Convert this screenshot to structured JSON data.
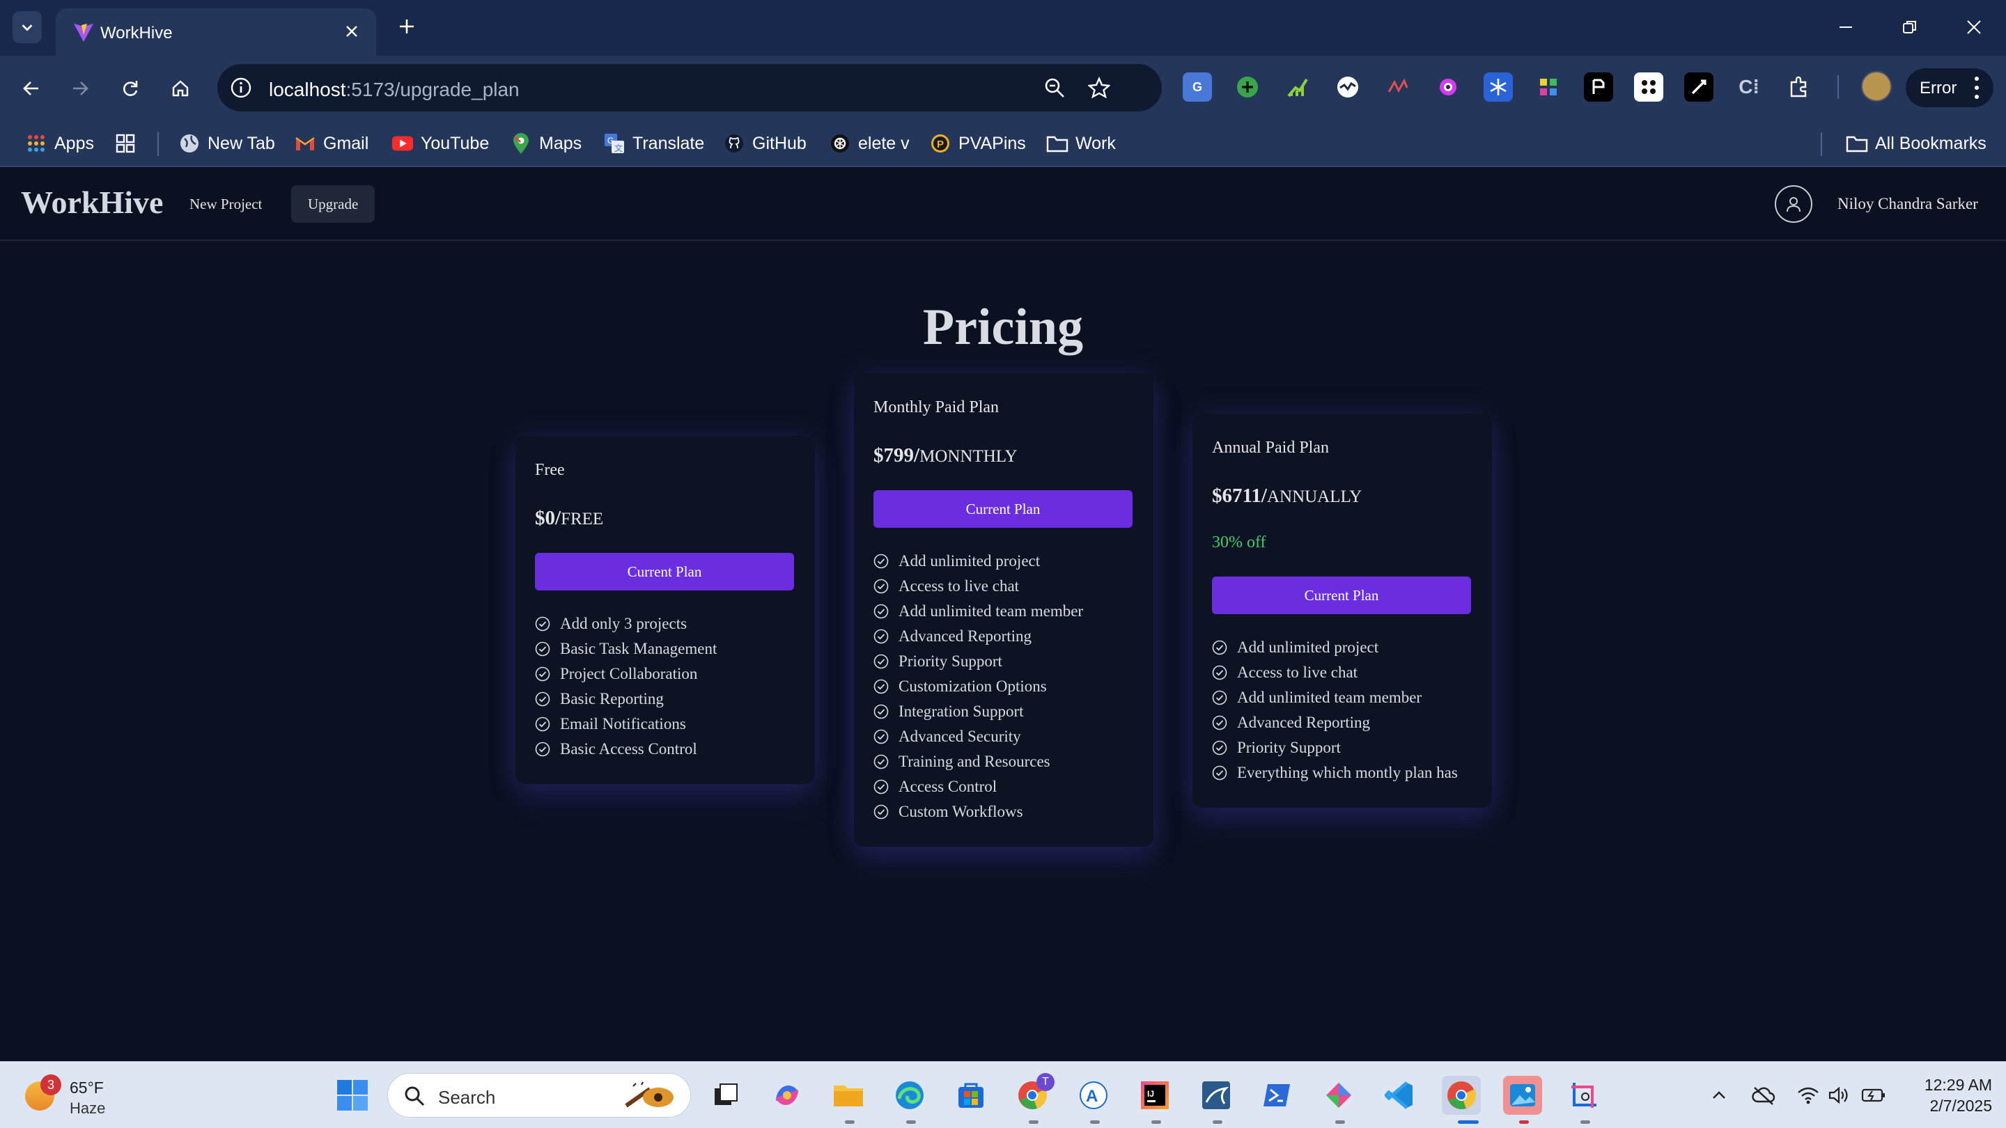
{
  "browser": {
    "tab_title": "WorkHive",
    "url_host": "localhost",
    "url_path": ":5173/upgrade_plan",
    "profile_chip": "Error",
    "bookmarks": [
      {
        "label": "Apps",
        "icon": "apps-grid-icon"
      },
      {
        "label": "",
        "icon": "tab-groups-icon"
      },
      {
        "label": "New Tab",
        "icon": "globe-icon"
      },
      {
        "label": "Gmail",
        "icon": "gmail-icon"
      },
      {
        "label": "YouTube",
        "icon": "youtube-icon"
      },
      {
        "label": "Maps",
        "icon": "maps-pin-icon"
      },
      {
        "label": "Translate",
        "icon": "translate-icon"
      },
      {
        "label": "GitHub",
        "icon": "github-icon"
      },
      {
        "label": "elete v",
        "icon": "openai-icon"
      },
      {
        "label": "PVAPins",
        "icon": "pvapins-icon"
      },
      {
        "label": "Work",
        "icon": "folder-icon"
      }
    ],
    "all_bookmarks": "All Bookmarks"
  },
  "app": {
    "brand": "WorkHive",
    "nav": {
      "new_project": "New Project",
      "upgrade": "Upgrade"
    },
    "user_name": "Niloy Chandra Sarker"
  },
  "page": {
    "title": "Pricing",
    "plans": [
      {
        "name": "Free",
        "price": "$0/",
        "period": "FREE",
        "discount": "",
        "cta": "Current Plan",
        "features": [
          "Add only 3 projects",
          "Basic Task Management",
          "Project Collaboration",
          "Basic Reporting",
          "Email Notifications",
          "Basic Access Control"
        ]
      },
      {
        "name": "Monthly Paid Plan",
        "price": "$799/",
        "period": "MONNTHLY",
        "discount": "",
        "cta": "Current Plan",
        "features": [
          "Add unlimited project",
          "Access to live chat",
          "Add unlimited team member",
          "Advanced Reporting",
          "Priority Support",
          "Customization Options",
          "Integration Support",
          "Advanced Security",
          "Training and Resources",
          "Access Control",
          "Custom Workflows"
        ]
      },
      {
        "name": "Annual Paid Plan",
        "price": "$6711/",
        "period": "ANNUALLY",
        "discount": "30% off",
        "cta": "Current Plan",
        "features": [
          "Add unlimited project",
          "Access to live chat",
          "Add unlimited team member",
          "Advanced Reporting",
          "Priority Support",
          "Everything which montly plan has"
        ]
      }
    ]
  },
  "taskbar": {
    "weather_temp": "65°F",
    "weather_cond": "Haze",
    "weather_badge": "3",
    "search_label": "Search",
    "chrome_badge": "T",
    "time": "12:29 AM",
    "date": "2/7/2025"
  },
  "colors": {
    "page_bg": "#0b1120",
    "accent_button": "#6a2ee0",
    "discount_green": "#3fcf6a",
    "browser_frame": "#24375b"
  }
}
